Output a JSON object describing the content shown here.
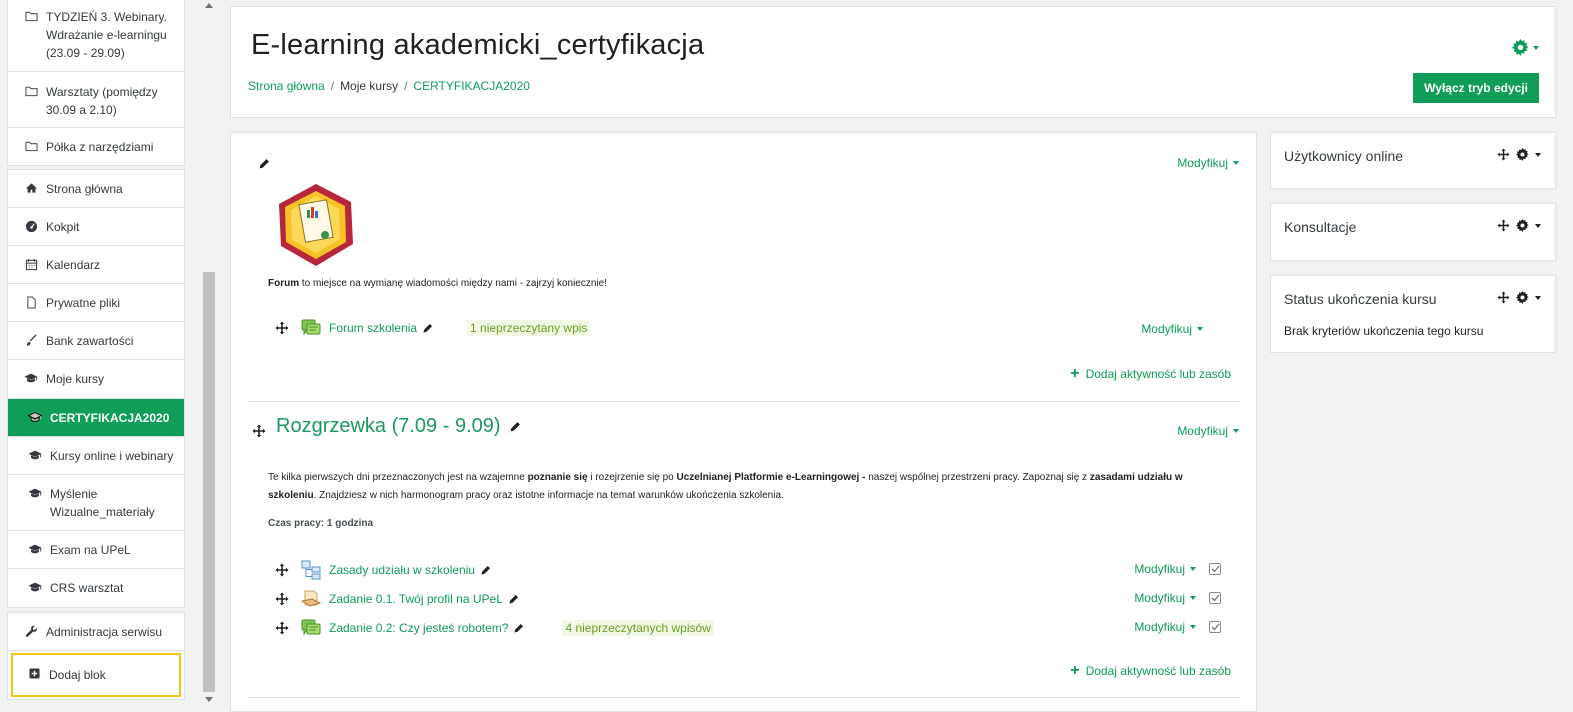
{
  "drawer": {
    "group1": [
      {
        "label": "TYDZIEŃ 3. Webinary. Wdrażanie e-learningu (23.09 - 29.09)",
        "icon": "folder-icon"
      },
      {
        "label": "Warsztaty (pomiędzy 30.09 a 2.10)",
        "icon": "folder-icon"
      },
      {
        "label": "Półka z narzędziami",
        "icon": "folder-icon"
      }
    ],
    "group2": [
      {
        "label": "Strona główna",
        "icon": "home-icon"
      },
      {
        "label": "Kokpit",
        "icon": "dashboard-icon"
      },
      {
        "label": "Kalendarz",
        "icon": "calendar-icon"
      },
      {
        "label": "Prywatne pliki",
        "icon": "file-icon"
      },
      {
        "label": "Bank zawartości",
        "icon": "brush-icon"
      },
      {
        "label": "Moje kursy",
        "icon": "graduation-cap-icon"
      },
      {
        "label": "CERTYFIKACJA2020",
        "icon": "graduation-cap-icon"
      },
      {
        "label": "Kursy online i webinary",
        "icon": "graduation-cap-icon"
      },
      {
        "label": "Myślenie Wizualne_materiały",
        "icon": "graduation-cap-icon"
      },
      {
        "label": "Exam na UPeL",
        "icon": "graduation-cap-icon"
      },
      {
        "label": "CRS warsztat",
        "icon": "graduation-cap-icon"
      }
    ],
    "group3": [
      {
        "label": "Administracja serwisu",
        "icon": "wrench-icon"
      },
      {
        "label": "Dodaj blok",
        "icon": "plus-square-icon"
      }
    ]
  },
  "header": {
    "title": "E-learning akademicki_certyfikacja",
    "breadcrumb": [
      "Strona główna",
      "Moje kursy",
      "CERTYFIKACJA2020"
    ],
    "edit_button": "Wyłącz tryb edycji"
  },
  "section0": {
    "modify": "Modyfikuj",
    "summary_bold": "Forum",
    "summary_rest": " to miejsce na wymianę wiadomości między nami - zajrzyj koniecznie!",
    "activities": [
      {
        "name": "Forum szkolenia",
        "unread": "1 nieprzeczytany wpis",
        "modify": "Modyfikuj",
        "icon": "forum-icon"
      }
    ],
    "add_activity": "Dodaj aktywność lub zasób"
  },
  "section1": {
    "title": "Rozgrzewka (7.09 - 9.09)",
    "modify": "Modyfikuj",
    "summary": {
      "t1": "Te kilka pierwszych dni przeznaczonych jest na wzajemne ",
      "b1": "poznanie się",
      "t2": " i rozejrzenie się po ",
      "b2": "Uczelnianej Platformie e-Learningowej -",
      "t3": " naszej wspólnej przestrzeni pracy. Zapoznaj się z ",
      "b3": "zasadami udziału w szkoleniu",
      "t4": ". Znajdziesz w nich harmonogram pracy oraz istotne informacje na temat warunków ukończenia szkolenia."
    },
    "work_time": "Czas pracy: 1 godzina",
    "activities": [
      {
        "name": "Zasady udziału w szkoleniu",
        "modify": "Modyfikuj",
        "icon": "book-icon"
      },
      {
        "name": "Zadanie 0.1. Twój profil na UPeL",
        "modify": "Modyfikuj",
        "icon": "assignment-icon"
      },
      {
        "name": "Zadanie 0.2: Czy jesteś robotem?",
        "unread": "4 nieprzeczytanych wpisów",
        "modify": "Modyfikuj",
        "icon": "forum-icon"
      }
    ],
    "add_activity": "Dodaj aktywność lub zasób"
  },
  "blocks": [
    {
      "title": "Użytkownicy online"
    },
    {
      "title": "Konsultacje"
    },
    {
      "title": "Status ukończenia kursu",
      "text": "Brak kryteriów ukończenia tego kursu"
    }
  ],
  "colors": {
    "accent": "#0f9d58",
    "highlight": "#f5c518",
    "unread_bg": "#f2f8e6"
  }
}
